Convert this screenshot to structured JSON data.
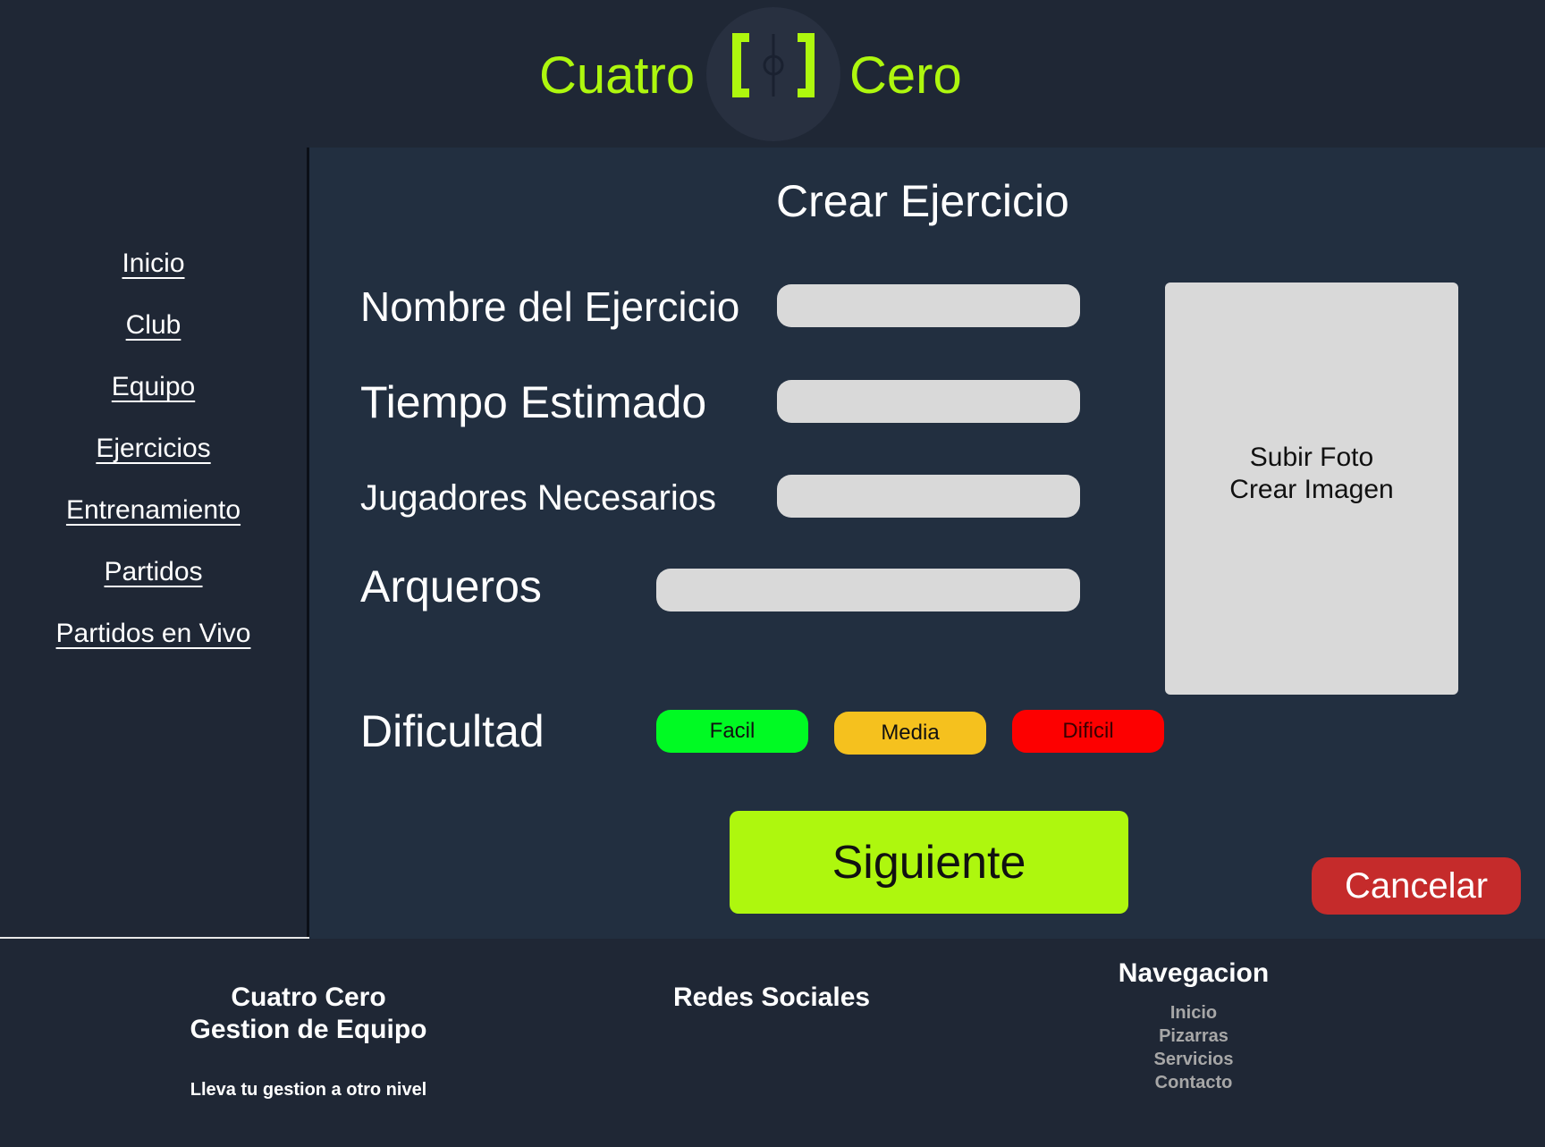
{
  "header": {
    "brand_left": "Cuatro",
    "brand_right": "Cero",
    "logo_icon": "field-bracket-logo-icon",
    "accent": "#aef70e"
  },
  "sidebar": {
    "items": [
      {
        "label": "Inicio"
      },
      {
        "label": "Club"
      },
      {
        "label": "Equipo"
      },
      {
        "label": "Ejercicios"
      },
      {
        "label": "Entrenamiento"
      },
      {
        "label": "Partidos"
      },
      {
        "label": "Partidos en Vivo"
      }
    ]
  },
  "main": {
    "title": "Crear Ejercicio",
    "fields": {
      "nombre_label": "Nombre del Ejercicio",
      "nombre_value": "",
      "tiempo_label": "Tiempo Estimado",
      "tiempo_value": "",
      "jugadores_label": "Jugadores Necesarios",
      "jugadores_value": "",
      "arqueros_label": "Arqueros",
      "arqueros_value": ""
    },
    "photo": {
      "line1": "Subir Foto",
      "line2": "Crear Imagen"
    },
    "difficulty": {
      "label": "Dificultad",
      "options": [
        {
          "label": "Facil",
          "color": "#00fa23"
        },
        {
          "label": "Media",
          "color": "#f5c11e"
        },
        {
          "label": "Dificil",
          "color": "#fd0000"
        }
      ]
    },
    "next_label": "Siguiente",
    "cancel_label": "Cancelar"
  },
  "footer": {
    "brand_line1": "Cuatro Cero",
    "brand_line2": "Gestion de Equipo",
    "tagline": "Lleva tu gestion a otro nivel",
    "social_title": "Redes Sociales",
    "nav_title": "Navegacion",
    "nav_links": [
      "Inicio",
      "Pizarras",
      "Servicios",
      "Contacto"
    ]
  }
}
